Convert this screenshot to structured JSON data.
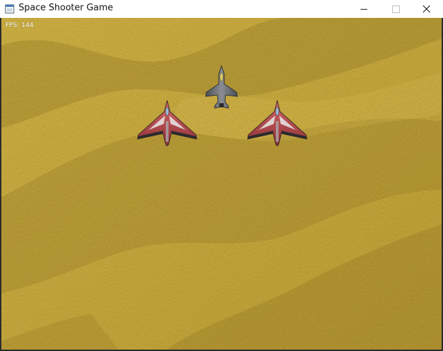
{
  "window": {
    "title": "Space Shooter Game",
    "controls": [
      "minimize",
      "maximize",
      "close"
    ]
  },
  "hud": {
    "fps_text": "FPS: 144"
  },
  "scene": {
    "background": "desert-sand-texture",
    "colors": {
      "sand": "#c9a93a",
      "sand_dark": "#a88a2a",
      "player_body": "#6b6e73",
      "enemy_body": "#b94848"
    }
  },
  "sprites": {
    "player": "player-jet-icon",
    "enemies": [
      "enemy-jet-icon",
      "enemy-jet-icon"
    ]
  }
}
